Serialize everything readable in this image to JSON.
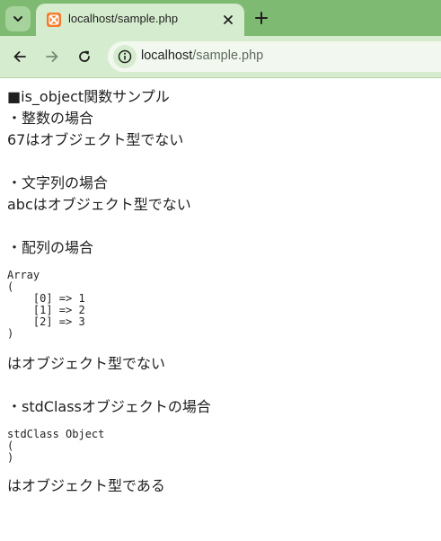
{
  "tab": {
    "title": "localhost/sample.php"
  },
  "address_bar": {
    "host": "localhost",
    "path": "/sample.php"
  },
  "page": {
    "heading": "■is_object関数サンプル",
    "int_title": "・整数の場合",
    "int_result": "67はオブジェクト型でない",
    "str_title": "・文字列の場合",
    "str_result": "abcはオブジェクト型でない",
    "arr_title": "・配列の場合",
    "arr_dump": "Array\n(\n    [0] => 1\n    [1] => 2\n    [2] => 3\n)",
    "arr_result": "はオブジェクト型でない",
    "obj_title": "・stdClassオブジェクトの場合",
    "obj_dump": "stdClass Object\n(\n)",
    "obj_result": "はオブジェクト型である"
  },
  "icons": {
    "tab_menu": "chevron-down-icon",
    "favicon": "xampp-icon",
    "tab_close": "close-icon",
    "new_tab": "plus-icon",
    "back": "arrow-left-icon",
    "forward": "arrow-right-icon",
    "reload": "reload-icon",
    "site_info": "site-info-icon"
  },
  "colors": {
    "tabstrip": "#7fba73",
    "toolbar": "#d5ecce",
    "favicon": "#f47c2a"
  }
}
